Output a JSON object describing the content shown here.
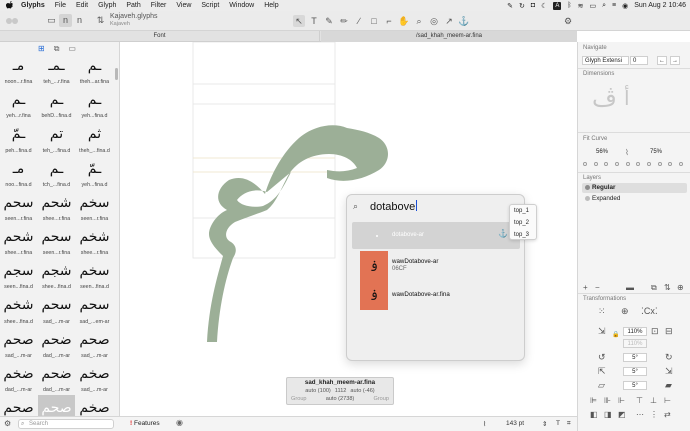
{
  "menubar": {
    "app_name": "Glyphs",
    "menus": [
      "File",
      "Edit",
      "Glyph",
      "Path",
      "Filter",
      "View",
      "Script",
      "Window",
      "Help"
    ],
    "status_badge": "A",
    "clock": "Sun Aug 2  10:46"
  },
  "window": {
    "title": "Kajaveh.glyphs",
    "subtitle": "Kajaveh"
  },
  "tabs": [
    {
      "label": "Font"
    },
    {
      "label": "/sad_khah_meem-ar.fina"
    }
  ],
  "glyph_grid": [
    {
      "glyph": "مـ",
      "name": "noon...r.fina"
    },
    {
      "glyph": "ـمـ",
      "name": "teh_...r.fina"
    },
    {
      "glyph": "ـم",
      "name": "theh...ar.fina"
    },
    {
      "glyph": "ـم",
      "name": "yeh...r.fina"
    },
    {
      "glyph": "ـم",
      "name": "behD...fina.d"
    },
    {
      "glyph": "ـم",
      "name": "yeh...fina.d"
    },
    {
      "glyph": "ـمّ",
      "name": "peh...fina.d"
    },
    {
      "glyph": "تم",
      "name": "teh_...fina.d"
    },
    {
      "glyph": "ثم",
      "name": "theh_...fina.d"
    },
    {
      "glyph": "مـ",
      "name": "noo...fina.d"
    },
    {
      "glyph": "ـم",
      "name": "tch_...fina.d"
    },
    {
      "glyph": "ـمّ",
      "name": "yeh...fina.d"
    },
    {
      "glyph": "سحم",
      "name": "seen...r.fina"
    },
    {
      "glyph": "شحم",
      "name": "shee...r.fina"
    },
    {
      "glyph": "سخم",
      "name": "seen...r.fina"
    },
    {
      "glyph": "شحم",
      "name": "shee...r.fina"
    },
    {
      "glyph": "سحم",
      "name": "seen...r.fina"
    },
    {
      "glyph": "شخم",
      "name": "shee...r.fina"
    },
    {
      "glyph": "سجم",
      "name": "seen...fina.d"
    },
    {
      "glyph": "شجم",
      "name": "shee...fina.d"
    },
    {
      "glyph": "سخم",
      "name": "seen...fina.d"
    },
    {
      "glyph": "شخم",
      "name": "shee...fina.d"
    },
    {
      "glyph": "سحم",
      "name": "sad_...m-ar"
    },
    {
      "glyph": "سحم",
      "name": "sad_...em-ar"
    },
    {
      "glyph": "صحم",
      "name": "sad_...m-ar"
    },
    {
      "glyph": "ضحم",
      "name": "dad_...m-ar"
    },
    {
      "glyph": "صحم",
      "name": "sad_...m-ar"
    },
    {
      "glyph": "ضخم",
      "name": "dad_...m-ar"
    },
    {
      "glyph": "ضحم",
      "name": "dad_...m-ar"
    },
    {
      "glyph": "صخم",
      "name": "sad_...m-ar"
    },
    {
      "glyph": "صحم",
      "name": "sad_...m-ar"
    },
    {
      "glyph": "صحم",
      "name": "sad_...r.fina"
    },
    {
      "glyph": "صخم",
      "name": "sad_...r.fina"
    }
  ],
  "bottombar": {
    "search_placeholder": "Search",
    "features_label": "Features",
    "zoom": "143 pt"
  },
  "canvas": {
    "glyph_color": "#9caf97"
  },
  "glyph_info": {
    "name": "sad_khah_meem-ar.fina",
    "left_sb": "auto (100)",
    "width_value": "1112",
    "right_sb": "auto (-46)",
    "width_auto": "auto (2738)",
    "group_left": "Group",
    "group_right": "Group"
  },
  "search_popup": {
    "query": "dotabove",
    "highlight_item": "dotabove-ar",
    "results": [
      {
        "glyph": "ۏ",
        "name": "wawDotabove-ar",
        "code": "06CF"
      },
      {
        "glyph": "ۏ",
        "name": "wawDotabove-ar.fina",
        "code": ""
      }
    ],
    "anchors": [
      "top_1",
      "top_2",
      "top_3"
    ],
    "result_color": "#e27354"
  },
  "inspector": {
    "navigate_title": "Navigate",
    "navigate_field": "Glyph Extensi",
    "navigate_value": "0",
    "dimensions_title": "Dimensions",
    "fit_curve_title": "Fit Curve",
    "fit_curve_min": "56%",
    "fit_curve_max": "75%",
    "layers_title": "Layers",
    "layers": [
      {
        "name": "Regular",
        "selected": true
      },
      {
        "name": "Expanded",
        "selected": false
      }
    ],
    "transformations_title": "Transformations",
    "scale_value": "110%",
    "scale_value_2": "110%",
    "rotate_value": "5°",
    "skew_value": "5°",
    "slant_value": "5°"
  }
}
